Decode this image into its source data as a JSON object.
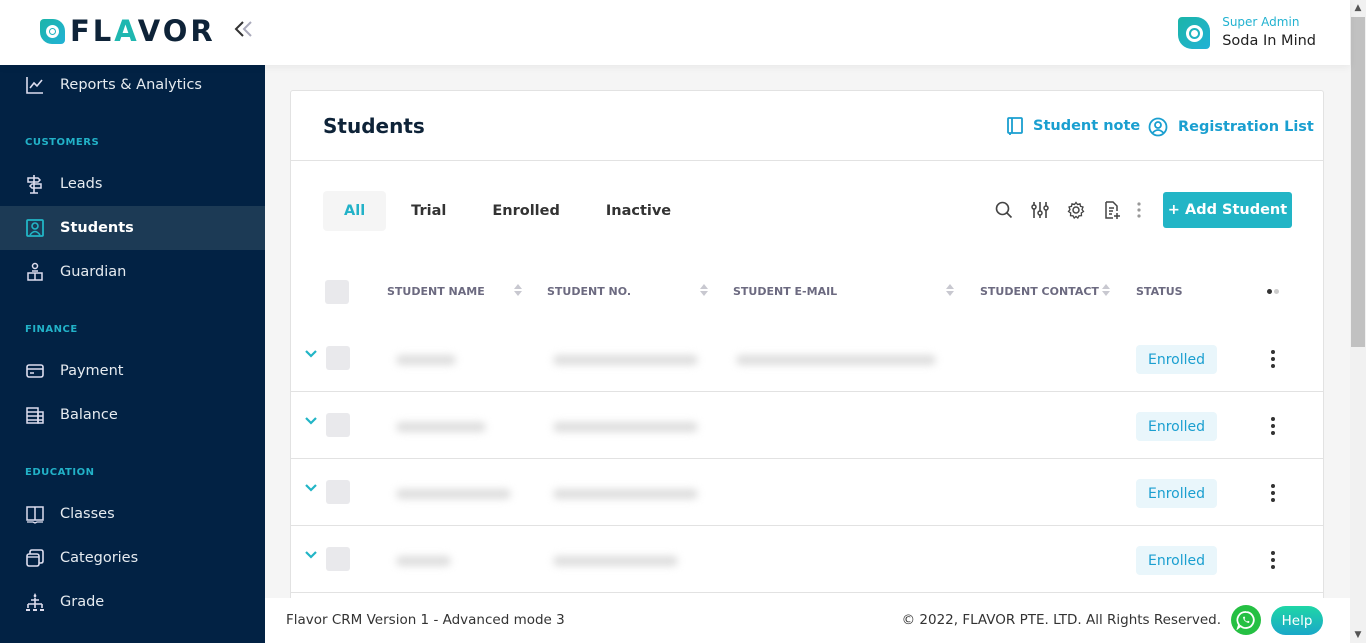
{
  "brand": {
    "logo_text_1": "FL",
    "logo_text_v": "A",
    "logo_text_2": "VOR",
    "accent_color": "#22b5c6",
    "sidebar_color": "#022244"
  },
  "header": {
    "collapse_icon": "double-chevron-left-icon",
    "user_role": "Super Admin",
    "user_name": "Soda In Mind"
  },
  "sidebar": {
    "items": [
      {
        "label": "Reports & Analytics",
        "icon": "chart-line-icon"
      },
      {
        "label": "Leads",
        "icon": "signpost-icon"
      },
      {
        "label": "Students",
        "icon": "user-square-icon",
        "active": true
      },
      {
        "label": "Guardian",
        "icon": "guardian-icon"
      },
      {
        "label": "Payment",
        "icon": "credit-card-icon"
      },
      {
        "label": "Balance",
        "icon": "ledger-icon"
      },
      {
        "label": "Classes",
        "icon": "book-open-icon"
      },
      {
        "label": "Categories",
        "icon": "stacked-squares-icon"
      },
      {
        "label": "Grade",
        "icon": "hierarchy-icon"
      }
    ],
    "sections": {
      "customers": "CUSTOMERS",
      "finance": "FINANCE",
      "education": "EDUCATION"
    }
  },
  "page": {
    "title": "Students",
    "links": {
      "student_note": "Student note",
      "registration_list": "Registration List"
    },
    "tabs": [
      {
        "label": "All",
        "active": true
      },
      {
        "label": "Trial"
      },
      {
        "label": "Enrolled"
      },
      {
        "label": "Inactive"
      }
    ],
    "toolbar": {
      "icons": [
        "search-icon",
        "filter-sliders-icon",
        "gear-icon",
        "export-document-icon",
        "more-vertical-icon"
      ],
      "add_label": "+ Add Student"
    },
    "table": {
      "columns": [
        "STUDENT NAME",
        "STUDENT NO.",
        "STUDENT E-MAIL",
        "STUDENT CONTACT",
        "STATUS"
      ],
      "rows": [
        {
          "name": "",
          "number": "",
          "email": "",
          "contact": "",
          "status": "Enrolled"
        },
        {
          "name": "",
          "number": "",
          "email": "",
          "contact": "",
          "status": "Enrolled"
        },
        {
          "name": "",
          "number": "",
          "email": "",
          "contact": "",
          "status": "Enrolled"
        },
        {
          "name": "",
          "number": "",
          "email": "",
          "contact": "",
          "status": "Enrolled"
        }
      ]
    }
  },
  "footer": {
    "version": "Flavor CRM Version 1 - Advanced mode 3",
    "copyright": "© 2022, FLAVOR PTE. LTD. All Rights Reserved.",
    "help_label": "Help"
  }
}
